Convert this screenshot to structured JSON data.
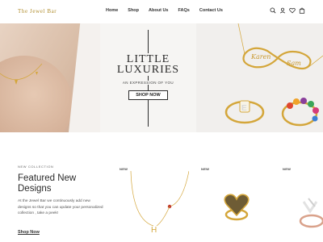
{
  "header": {
    "logo": "The Jewel Bar",
    "nav": [
      "Home",
      "Shop",
      "About Us",
      "FAQs",
      "Contact Us"
    ],
    "icons": [
      "search-icon",
      "account-icon",
      "wishlist-heart-icon",
      "cart-bag-icon"
    ]
  },
  "hero": {
    "title_line1": "LITTLE",
    "title_line2": "LUXURIES",
    "subtitle": "AN EXPRESSION OF YOU",
    "button_label": "SHOP NOW",
    "colors": {
      "gold": "#d4a63a",
      "skin": "#d9bda7",
      "background": "#f6f5f3"
    },
    "necklace_names": [
      "Karen",
      "Sam"
    ]
  },
  "featured": {
    "eyebrow": "NEW COLLECTION",
    "title": "Featured New Designs",
    "description": "At the Jewel Bar we continuously add new designs so that you can update your personalized collection , take a peek!",
    "link_label": "Shop Now",
    "products": [
      {
        "badge": "NEW",
        "image": "initial-h-necklace"
      },
      {
        "badge": "NEW",
        "image": "heart-signet-ring"
      },
      {
        "badge": "NEW",
        "image": "rose-gold-ring"
      }
    ]
  }
}
